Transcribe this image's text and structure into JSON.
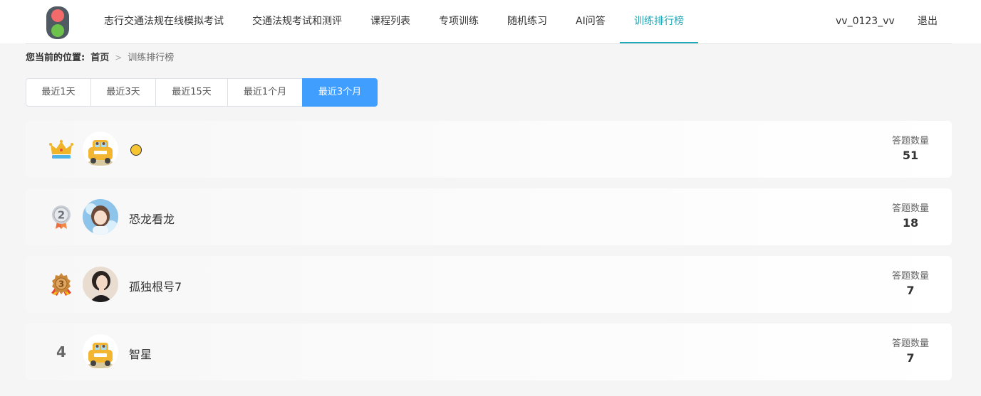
{
  "header": {
    "nav": [
      {
        "label": "志行交通法规在线模拟考试"
      },
      {
        "label": "交通法规考试和测评"
      },
      {
        "label": "课程列表"
      },
      {
        "label": "专项训练"
      },
      {
        "label": "随机练习"
      },
      {
        "label": "AI问答"
      },
      {
        "label": "训练排行榜",
        "active": true
      }
    ],
    "username": "vv_0123_vv",
    "logout": "退出"
  },
  "breadcrumb": {
    "label": "您当前的位置:",
    "home": "首页",
    "separator": ">",
    "current": "训练排行榜"
  },
  "filters": {
    "tabs": [
      "最近1天",
      "最近3天",
      "最近15天",
      "最近1个月",
      "最近3个月"
    ],
    "selected": "最近3个月"
  },
  "ranking": {
    "stat_label": "答题数量",
    "rows": [
      {
        "rank": "1",
        "badge": "crown-icon",
        "avatar": "taxi-avatar",
        "name": "",
        "count": "51"
      },
      {
        "rank": "2",
        "badge": "silver-medal-icon",
        "avatar": "girl-avatar",
        "name": "恐龙看龙",
        "count": "18"
      },
      {
        "rank": "3",
        "badge": "bronze-medal-icon",
        "avatar": "woman-avatar",
        "name": "孤独根号7",
        "count": "7"
      },
      {
        "rank": "4",
        "badge": "",
        "avatar": "taxi-avatar",
        "name": "智星",
        "count": "7"
      }
    ]
  },
  "colors": {
    "accent": "#1fa8b8",
    "tab_active": "#409eff",
    "crown": "#f0b429",
    "silver": "#b8bcc4",
    "bronze": "#c9873a"
  }
}
